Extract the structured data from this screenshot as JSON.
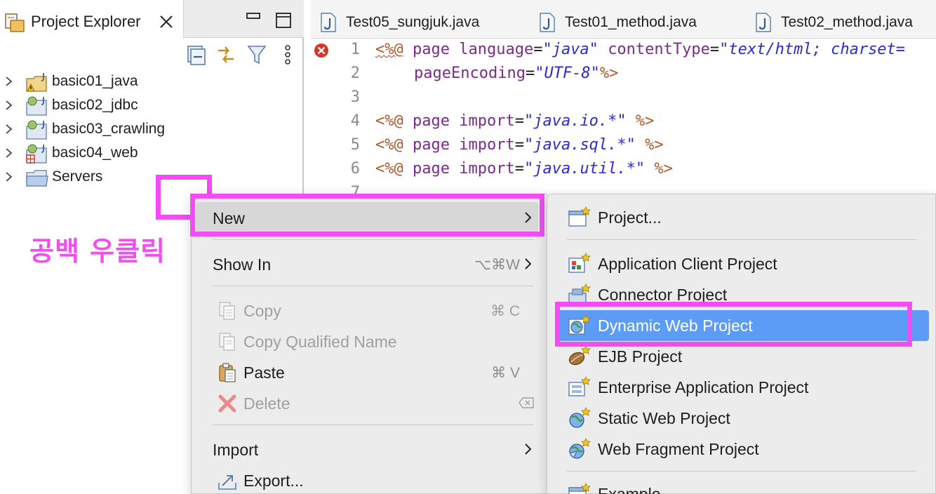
{
  "project_explorer": {
    "tab_title": "Project Explorer",
    "tree": [
      {
        "label": "basic01_java",
        "icon": "java-project-warning-icon"
      },
      {
        "label": "basic02_jdbc",
        "icon": "java-project-icon"
      },
      {
        "label": "basic03_crawling",
        "icon": "java-project-icon"
      },
      {
        "label": "basic04_web",
        "icon": "web-project-error-icon"
      },
      {
        "label": "Servers",
        "icon": "folder-icon"
      }
    ]
  },
  "editor": {
    "tabs": [
      {
        "label": "Test05_sungjuk.java"
      },
      {
        "label": "Test01_method.java"
      },
      {
        "label": "Test02_method.java"
      }
    ],
    "lines": [
      {
        "num": "1",
        "error": true
      },
      {
        "num": "2"
      },
      {
        "num": "3"
      },
      {
        "num": "4"
      },
      {
        "num": "5"
      },
      {
        "num": "6"
      },
      {
        "num": "7"
      }
    ],
    "code": {
      "l1_open": "<%@",
      "l1_page": "page",
      "l1_attr1": "language",
      "l1_eq": "=",
      "l1_val1": "\"java\"",
      "l1_attr2": "contentType",
      "l1_val2": "\"text/html; charset=",
      "l2_attr": "pageEncoding",
      "l2_val": "\"UTF-8\"",
      "l2_close": "%>",
      "import_kw": "import",
      "l4_val": "\"java.io.*\"",
      "l5_val": "\"java.sql.*\"",
      "l6_val": "\"java.util.*\"",
      "close": "%>"
    }
  },
  "annotation": {
    "text": "공백 우클릭",
    "color": "#f24cf2"
  },
  "context_menu": {
    "items": [
      {
        "label": "New",
        "has_submenu": true,
        "highlighted": true
      },
      {
        "label": "Show In",
        "shortcut": "⌥⌘W",
        "has_submenu": true
      },
      {
        "label": "Copy",
        "shortcut": "⌘ C",
        "disabled": true,
        "icon": "copy-icon"
      },
      {
        "label": "Copy Qualified Name",
        "disabled": true,
        "icon": "copy-qualified-name-icon"
      },
      {
        "label": "Paste",
        "shortcut": "⌘ V",
        "icon": "paste-icon"
      },
      {
        "label": "Delete",
        "disabled": true,
        "icon": "delete-icon"
      },
      {
        "label": "Import",
        "has_submenu": true
      },
      {
        "label": "Export...",
        "icon": "export-icon"
      }
    ]
  },
  "new_submenu": {
    "items": [
      {
        "label": "Project...",
        "icon": "new-project-icon"
      },
      {
        "label": "Application Client Project",
        "icon": "app-client-project-icon"
      },
      {
        "label": "Connector Project",
        "icon": "connector-project-icon"
      },
      {
        "label": "Dynamic Web Project",
        "icon": "dynamic-web-project-icon",
        "selected": true
      },
      {
        "label": "EJB Project",
        "icon": "ejb-project-icon"
      },
      {
        "label": "Enterprise Application Project",
        "icon": "enterprise-app-project-icon"
      },
      {
        "label": "Static Web Project",
        "icon": "static-web-project-icon"
      },
      {
        "label": "Web Fragment Project",
        "icon": "web-fragment-project-icon"
      },
      {
        "label": "Example...",
        "icon": "example-icon"
      }
    ]
  },
  "colors": {
    "accent_selection": "#5d9cf6",
    "annotation_magenta": "#f24cf2",
    "menu_background": "#ececec"
  }
}
